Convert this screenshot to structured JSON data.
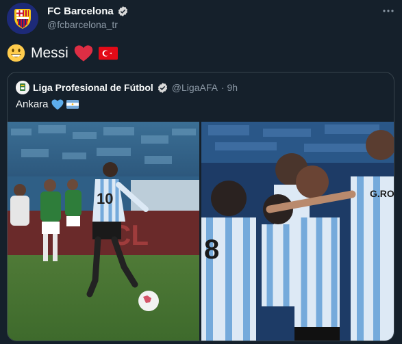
{
  "tweet": {
    "author_name": "FC Barcelona",
    "author_handle": "@fcbarcelona_tr",
    "more_icon": "more-horizontal-icon",
    "text": "Messi",
    "emojis": [
      "grinning-face-emoji",
      "red-heart-emoji",
      "turkey-flag-emoji"
    ]
  },
  "quote": {
    "author_name": "Liga Profesional de Fútbol",
    "author_handle": "@LigaAFA",
    "time": "· 9h",
    "text": "Ankara",
    "emojis": [
      "light-blue-heart-emoji",
      "argentina-flag-emoji"
    ],
    "images": [
      "penalty-kick-photo",
      "team-celebration-photo"
    ]
  },
  "colors": {
    "background": "#15202b",
    "border": "#38444d",
    "secondary_text": "#8b98a5",
    "verified": "#d9d9d9"
  }
}
